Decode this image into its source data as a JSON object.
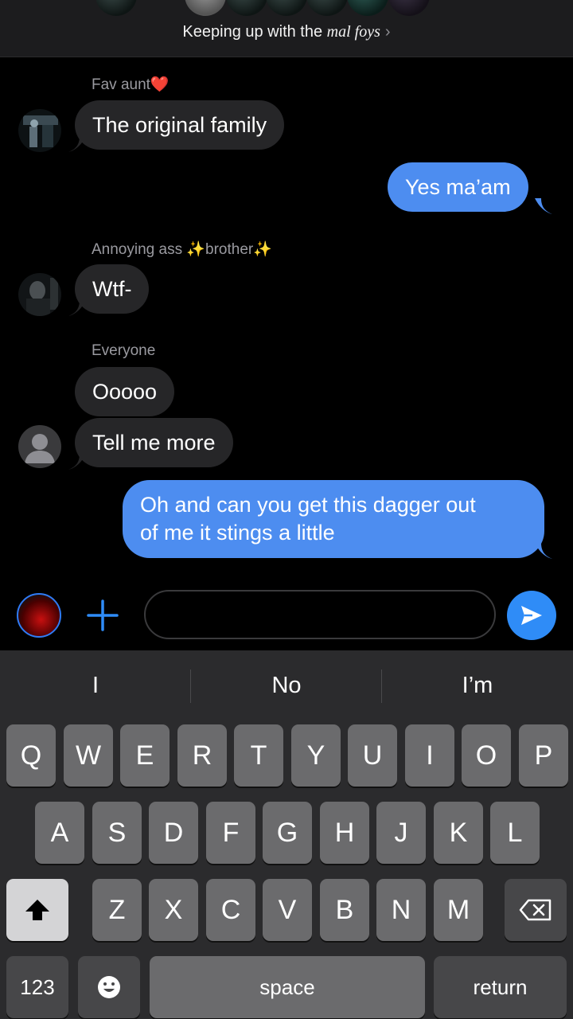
{
  "header": {
    "title_prefix": "Keeping up with the",
    "title_italic": "mal foys",
    "chevron": "›"
  },
  "messages": [
    {
      "type": "incoming",
      "sender": "Fav aunt❤️",
      "text": "The original family",
      "avatar": "photo"
    },
    {
      "type": "outgoing",
      "text": "Yes ma’am"
    },
    {
      "type": "incoming",
      "sender": "Annoying ass ✨brother✨",
      "text": "Wtf-",
      "avatar": "photo"
    },
    {
      "type": "incoming",
      "sender": "Everyone",
      "text": "Ooooo"
    },
    {
      "type": "incoming",
      "text": "Tell me more",
      "avatar": "default-person"
    },
    {
      "type": "outgoing",
      "lines": [
        "Oh and can you get this dagger out",
        "of me it stings a little"
      ]
    }
  ],
  "composer": {
    "input_value": "",
    "plus_icon": "plus-icon",
    "send_icon": "send-icon"
  },
  "keyboard": {
    "suggestions": [
      "I",
      "No",
      "I’m"
    ],
    "row1": [
      "Q",
      "W",
      "E",
      "R",
      "T",
      "Y",
      "U",
      "I",
      "O",
      "P"
    ],
    "row2": [
      "A",
      "S",
      "D",
      "F",
      "G",
      "H",
      "J",
      "K",
      "L"
    ],
    "row3": [
      "Z",
      "X",
      "C",
      "V",
      "B",
      "N",
      "M"
    ],
    "numbers_key": "123",
    "space_key": "space",
    "return_key": "return",
    "emoji_icon": "emoji-icon",
    "shift_icon": "shift-icon",
    "delete_icon": "delete-icon"
  },
  "colors": {
    "outgoing_bubble": "#4d8df0",
    "incoming_bubble": "#262628",
    "accent": "#2f8cf7",
    "keyboard_bg": "#2b2b2d"
  }
}
